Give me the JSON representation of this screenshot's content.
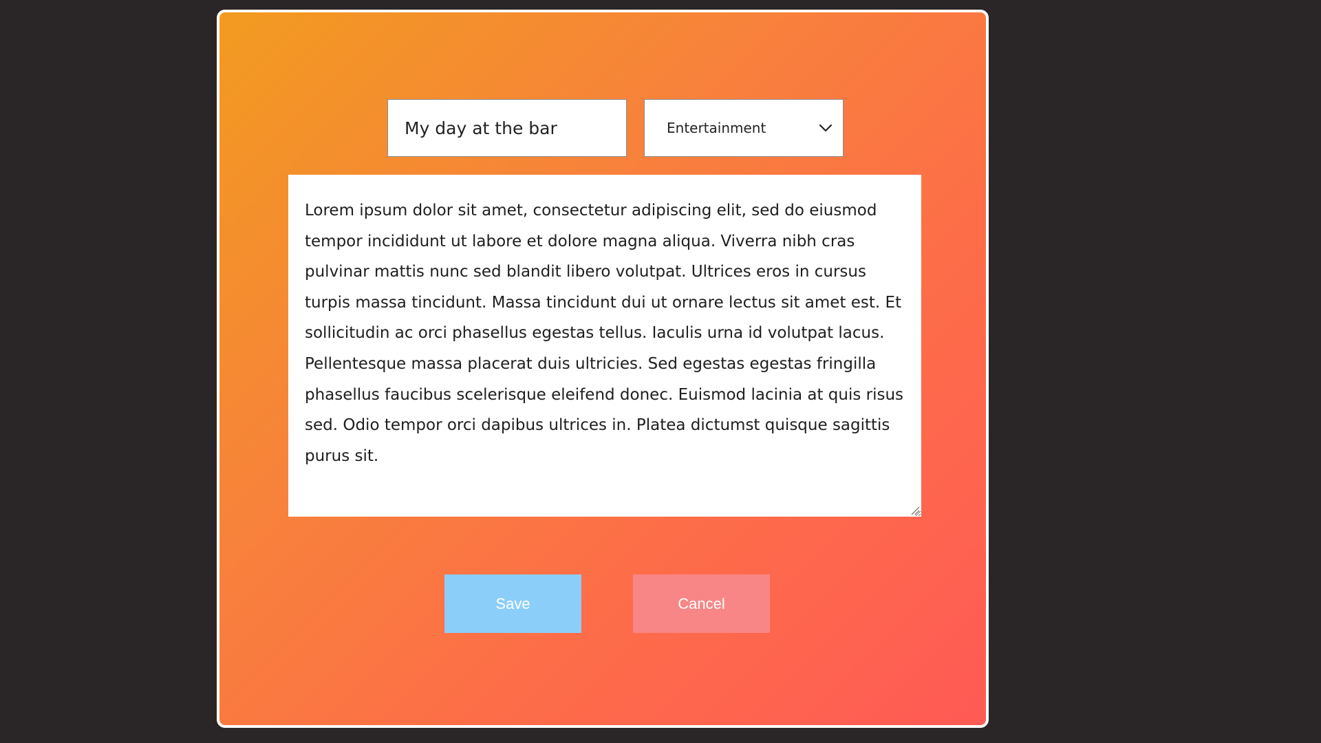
{
  "form": {
    "title_value": "My day at the bar",
    "category_selected": "Entertainment",
    "category_icon": "chevron-down-icon",
    "body_value": "Lorem ipsum dolor sit amet, consectetur adipiscing elit, sed do eiusmod tempor incididunt ut labore et dolore magna aliqua. Viverra nibh cras pulvinar mattis nunc sed blandit libero volutpat. Ultrices eros in cursus turpis massa tincidunt. Massa tincidunt dui ut ornare lectus sit amet est. Et sollicitudin ac orci phasellus egestas tellus. Iaculis urna id volutpat lacus. Pellentesque massa placerat duis ultricies. Sed egestas egestas fringilla phasellus faucibus scelerisque eleifend donec. Euismod lacinia at quis risus sed. Odio tempor orci dapibus ultrices in. Platea dictumst quisque sagittis purus sit."
  },
  "actions": {
    "save_label": "Save",
    "cancel_label": "Cancel"
  },
  "colors": {
    "page_background": "#2a2526",
    "panel_gradient_start": "#f29b20",
    "panel_gradient_end": "#ff5a55",
    "save_button": "#8ccefa",
    "cancel_button": "#f98686"
  }
}
